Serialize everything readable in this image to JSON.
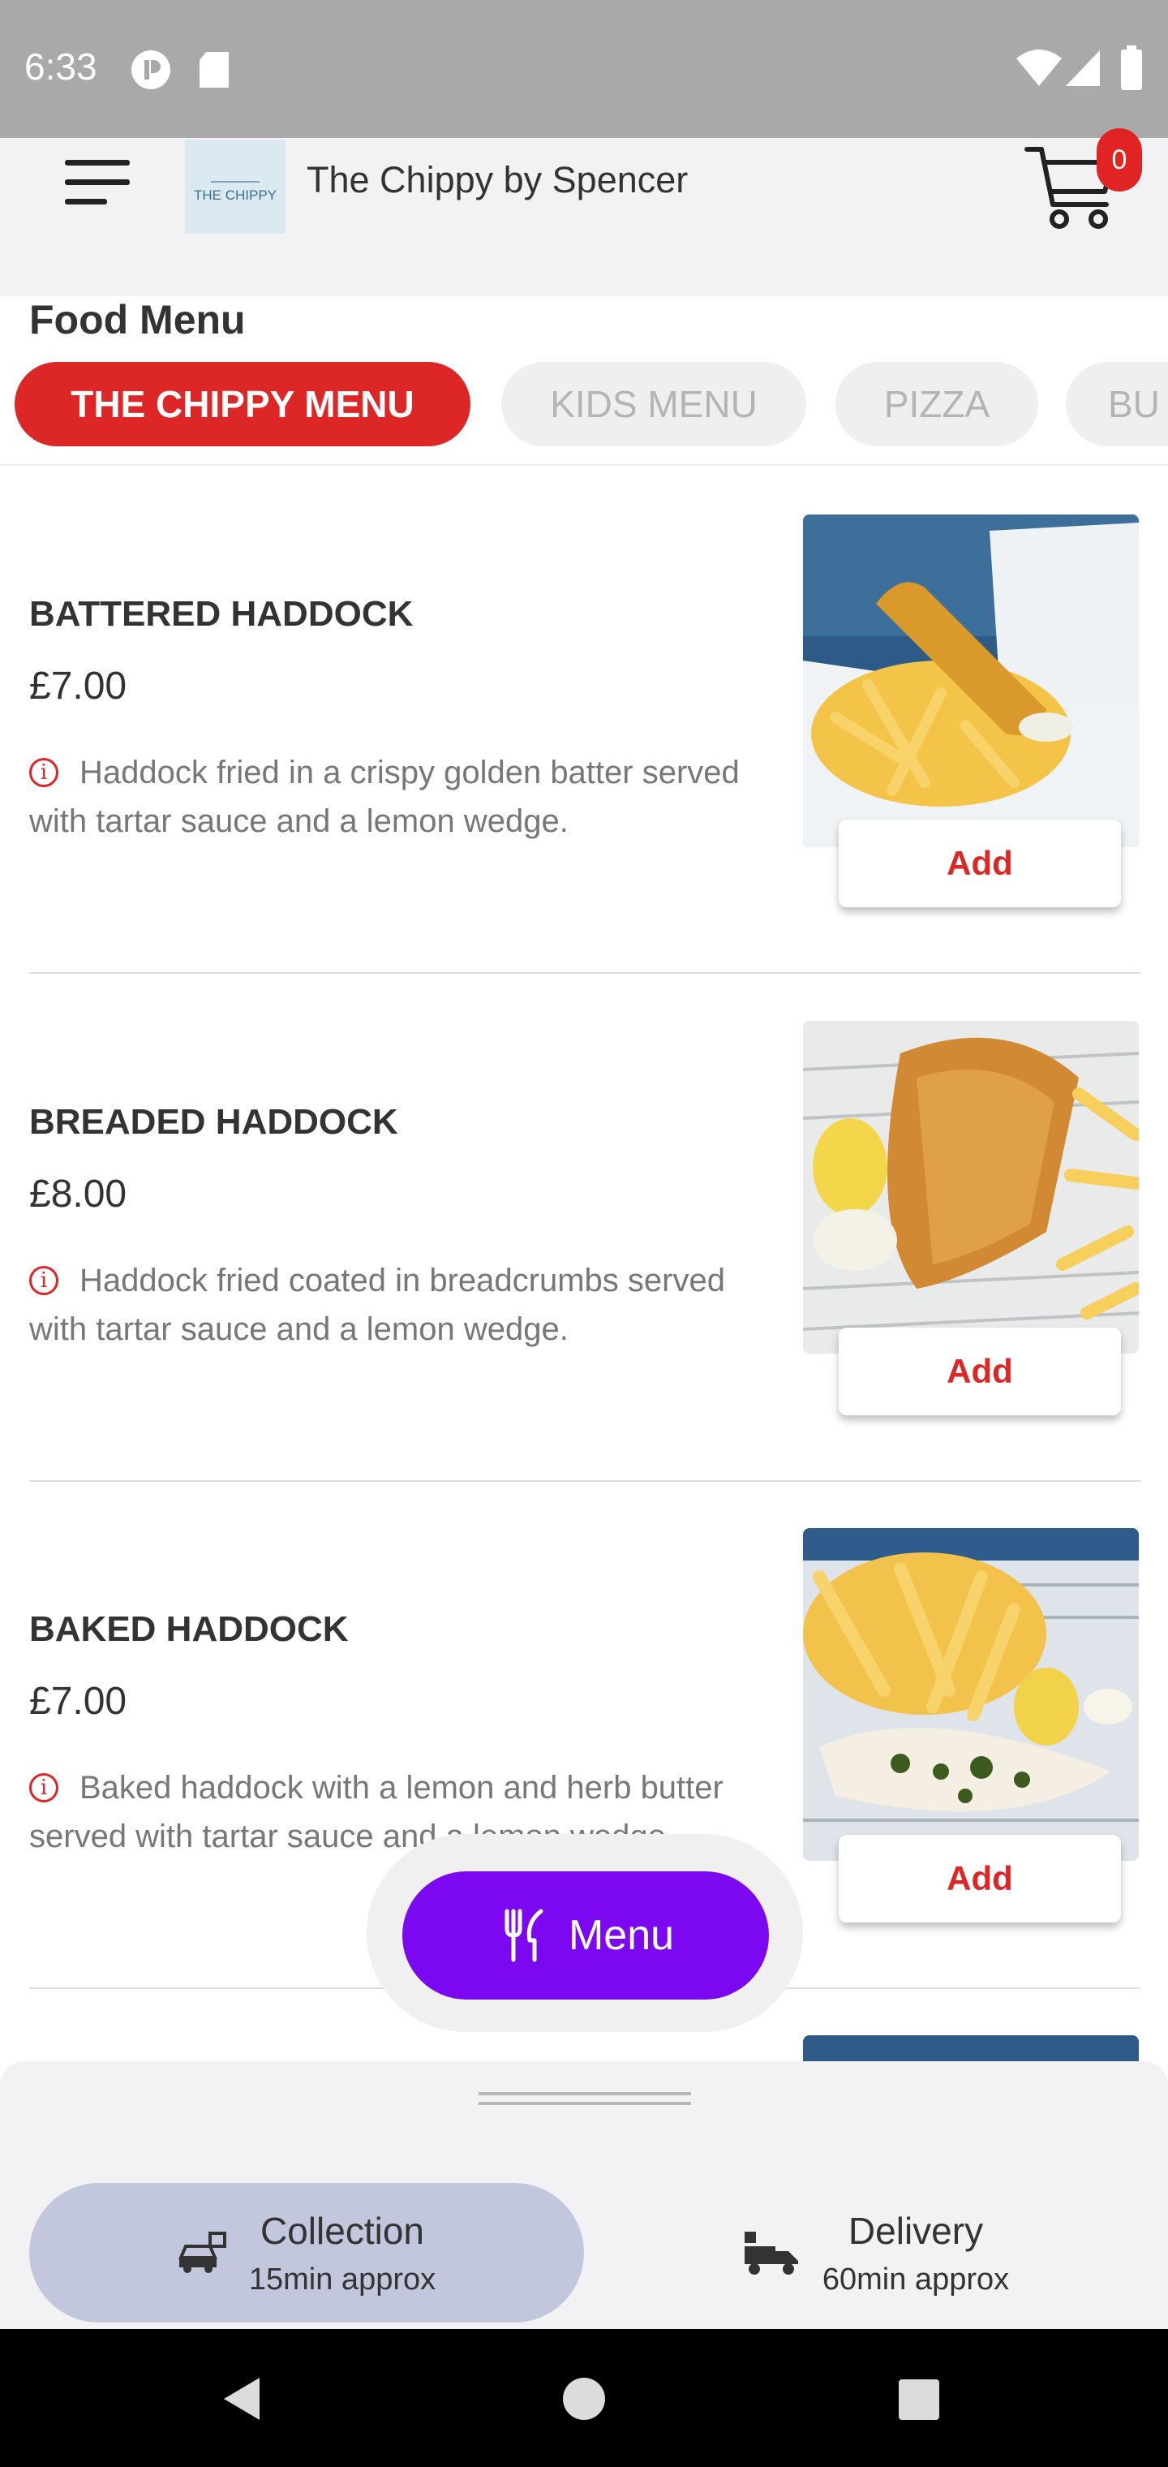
{
  "status_bar": {
    "time": "6:33"
  },
  "header": {
    "app_name": "The Chippy by Spencer",
    "logo_text": "THE CHIPPY",
    "cart_count": "0"
  },
  "food_menu": {
    "title": "Food Menu",
    "tabs": [
      {
        "label": "THE CHIPPY MENU",
        "active": true
      },
      {
        "label": "KIDS MENU",
        "active": false
      },
      {
        "label": "PIZZA",
        "active": false
      },
      {
        "label": "BU",
        "active": false
      }
    ]
  },
  "items": [
    {
      "name": "BATTERED HADDOCK",
      "price": "£7.00",
      "info_glyph": "i",
      "description": "Haddock fried in a crispy golden batter served with tartar sauce and a lemon wedge.",
      "add_label": "Add"
    },
    {
      "name": "BREADED HADDOCK",
      "price": "£8.00",
      "info_glyph": "i",
      "description": "Haddock fried coated in breadcrumbs served with tartar sauce and a lemon wedge.",
      "add_label": "Add"
    },
    {
      "name": "BAKED HADDOCK",
      "price": "£7.00",
      "info_glyph": "i",
      "description": "Baked haddock with a lemon and herb butter served with tartar sauce and a lemon wedge.",
      "add_label": "Add"
    }
  ],
  "menu_button": {
    "label": "Menu"
  },
  "order_modes": [
    {
      "title": "Collection",
      "subtitle": "15min approx",
      "active": true,
      "icon": "collection-car-icon"
    },
    {
      "title": "Delivery",
      "subtitle": "60min approx",
      "active": false,
      "icon": "delivery-truck-icon"
    }
  ],
  "colors": {
    "accent_red": "#dd2626",
    "menu_purple": "#7c08f2",
    "active_mode": "#c2c7dd"
  }
}
